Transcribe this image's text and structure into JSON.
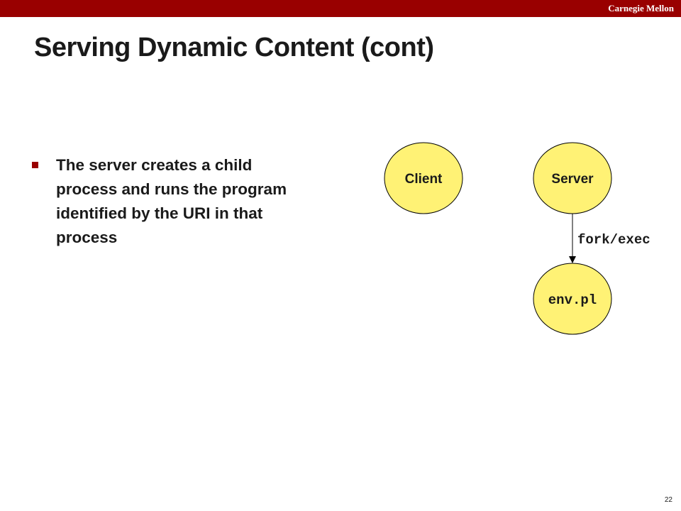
{
  "header": {
    "brand": "Carnegie Mellon"
  },
  "slide": {
    "title": "Serving Dynamic Content (cont)",
    "bullets": [
      "The server creates a child process and runs the program identified by the URI in that process"
    ],
    "page_number": "22"
  },
  "diagram": {
    "nodes": {
      "client": "Client",
      "server": "Server",
      "child": "env.pl"
    },
    "edge_label": "fork/exec",
    "colors": {
      "node_fill": "#fff275",
      "node_stroke": "#000000",
      "accent": "#990000"
    }
  }
}
